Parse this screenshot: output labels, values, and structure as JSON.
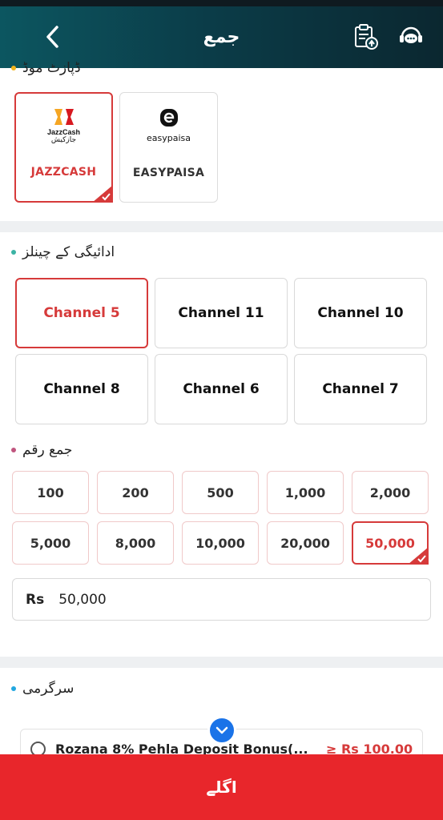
{
  "header": {
    "title": "جمع",
    "icons": [
      "chevron-left-icon",
      "clipboard-upload-icon",
      "support-chat-icon"
    ]
  },
  "deposit_mode": {
    "title": "ڈپازٹ موڈ",
    "dot_color": "#f2b31b",
    "options": [
      {
        "label": "JAZZCASH",
        "logo_line1": "JazzCash",
        "logo_line2": "جازکیش",
        "selected": true
      },
      {
        "label": "EASYPAISA",
        "logo_text": "easypaisa",
        "selected": false
      }
    ]
  },
  "channels": {
    "title": "ادائیگی کے چینلز",
    "dot_color": "#3bb3a4",
    "items": [
      "Channel 5",
      "Channel 11",
      "Channel 10",
      "Channel 8",
      "Channel 6",
      "Channel 7"
    ],
    "selected": "Channel 5"
  },
  "amount": {
    "title": "جمع رقم",
    "dot_color": "#c0557e",
    "presets": [
      "100",
      "200",
      "500",
      "1,000",
      "2,000",
      "5,000",
      "8,000",
      "10,000",
      "20,000",
      "50,000"
    ],
    "selected": "50,000",
    "currency": "Rs",
    "value": "50,000"
  },
  "activity": {
    "title": "سرگرمی",
    "dot_color": "#22a7e0",
    "promo_name": "Rozana 8% Pehla Deposit Bonus(...",
    "promo_min": "≥ Rs 100.00"
  },
  "footer": {
    "next_label": "اگلے"
  },
  "colors": {
    "accent": "#d63a3a",
    "primary_button": "#e8262b",
    "header_start": "#0c5660",
    "header_end": "#0b2730"
  }
}
